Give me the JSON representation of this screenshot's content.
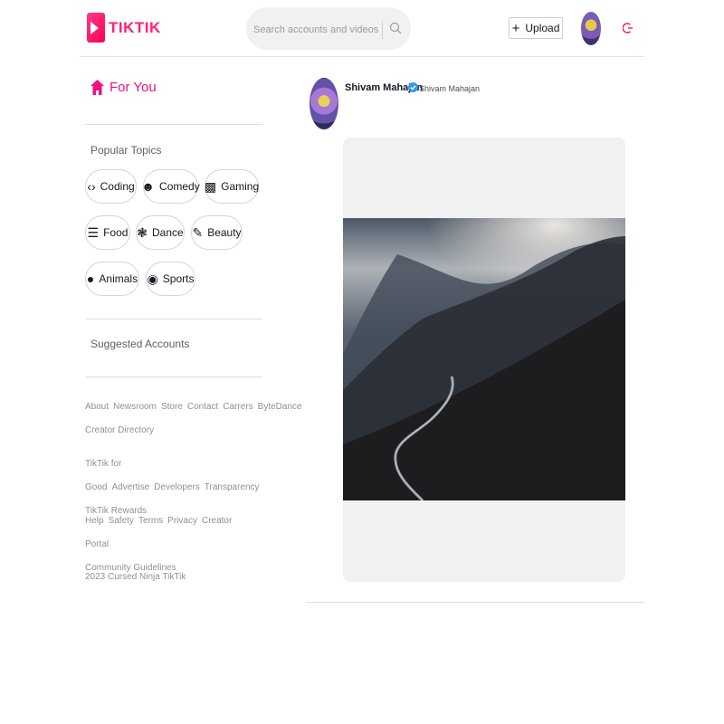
{
  "brand": {
    "name": "TIKTIK",
    "accent": "#ff1f77"
  },
  "header": {
    "search_placeholder": "Search accounts and videos",
    "upload_label": "Upload"
  },
  "sidebar": {
    "for_you": "For You",
    "popular_topics_title": "Popular Topics",
    "topics": [
      {
        "label": "Coding",
        "icon": "code-icon"
      },
      {
        "label": "Comedy",
        "icon": "sunglasses-face-icon"
      },
      {
        "label": "Gaming",
        "icon": "gamepad-icon"
      },
      {
        "label": "Food",
        "icon": "cake-icon"
      },
      {
        "label": "Dance",
        "icon": "dance-icon"
      },
      {
        "label": "Beauty",
        "icon": "lipstick-icon"
      },
      {
        "label": "Animals",
        "icon": "paw-icon"
      },
      {
        "label": "Sports",
        "icon": "medal-icon"
      }
    ],
    "suggested_accounts_title": "Suggested Accounts",
    "footer_groups": [
      [
        "About",
        "Newsroom",
        "Store",
        "Contact",
        "Carrers",
        "ByteDance",
        "Creator Directory"
      ],
      [
        "TikTik for Good",
        "Advertise",
        "Developers",
        "Transparency",
        "TikTik Rewards"
      ],
      [
        "Help",
        "Safety",
        "Terms",
        "Privacy",
        "Creator Portal",
        "Community Guidelines"
      ]
    ],
    "copyright": "2023 Cursed Ninja TikTik"
  },
  "post": {
    "author_name": "Shivam Mahajan",
    "author_handle": "Shivam Mahajan",
    "verified": true
  }
}
